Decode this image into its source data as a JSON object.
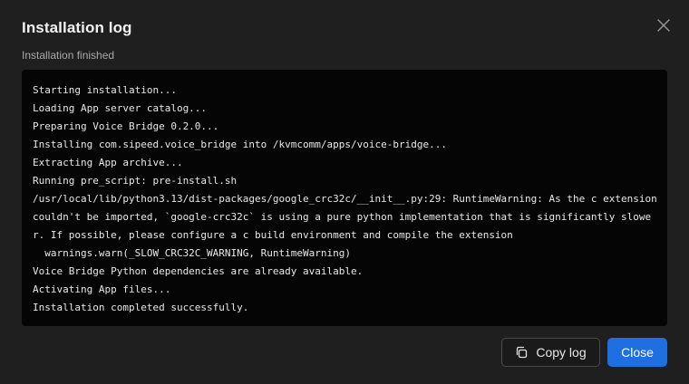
{
  "dialog": {
    "title": "Installation log",
    "subtitle": "Installation finished"
  },
  "icons": {
    "close": "close-icon",
    "copy": "copy-icon"
  },
  "log": {
    "lines": [
      "Starting installation...",
      "Loading App server catalog...",
      "Preparing Voice Bridge 0.2.0...",
      "Installing com.sipeed.voice_bridge into /kvmcomm/apps/voice-bridge...",
      "Extracting App archive...",
      "Running pre_script: pre-install.sh",
      "/usr/local/lib/python3.13/dist-packages/google_crc32c/__init__.py:29: RuntimeWarning: As the c extension",
      "couldn't be imported, `google-crc32c` is using a pure python implementation that is significantly slowe",
      "r. If possible, please configure a c build environment and compile the extension",
      "  warnings.warn(_SLOW_CRC32C_WARNING, RuntimeWarning)",
      "Voice Bridge Python dependencies are already available.",
      "Activating App files...",
      "Installation completed successfully."
    ]
  },
  "buttons": {
    "copy_label": "Copy log",
    "close_label": "Close"
  },
  "colors": {
    "background": "#1f1f1f",
    "log_background": "#050505",
    "primary": "#1e6fe0"
  }
}
